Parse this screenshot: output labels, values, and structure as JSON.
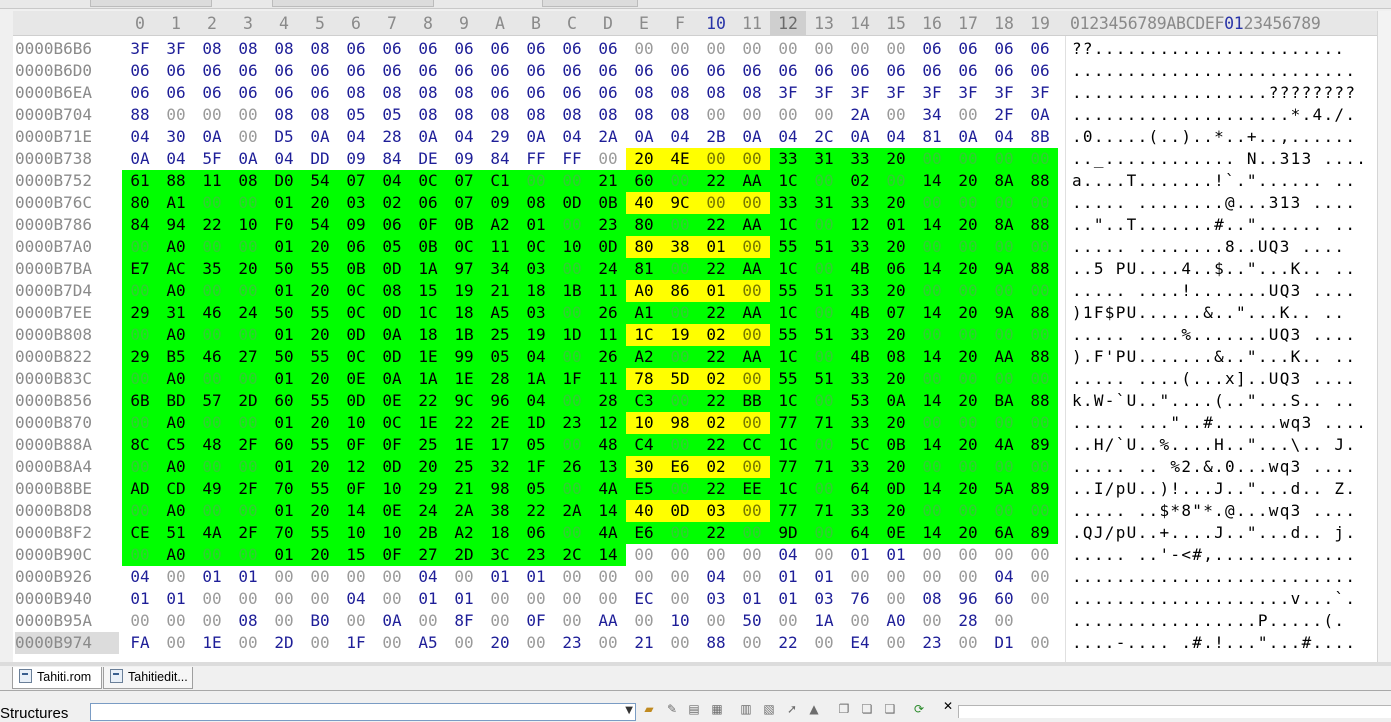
{
  "columns": [
    "0",
    "1",
    "2",
    "3",
    "4",
    "5",
    "6",
    "7",
    "8",
    "9",
    "A",
    "B",
    "C",
    "D",
    "E",
    "F",
    "10",
    "11",
    "12",
    "13",
    "14",
    "15",
    "16",
    "17",
    "18",
    "19"
  ],
  "current_column": "10",
  "selected_column": "12",
  "ascii_header": {
    "before": "0123456789ABCDEF",
    "cur": "01",
    "after": "23456789"
  },
  "rows": [
    {
      "offset": "0000B6B6",
      "bytes": [
        "3F",
        "3F",
        "08",
        "08",
        "08",
        "08",
        "06",
        "06",
        "06",
        "06",
        "06",
        "06",
        "06",
        "06",
        "00",
        "00",
        "00",
        "00",
        "00",
        "00",
        "00",
        "00",
        "06",
        "06",
        "06",
        "06"
      ],
      "ascii": "??......................."
    },
    {
      "offset": "0000B6D0",
      "bytes": [
        "06",
        "06",
        "06",
        "06",
        "06",
        "06",
        "06",
        "06",
        "06",
        "06",
        "06",
        "06",
        "06",
        "06",
        "06",
        "06",
        "06",
        "06",
        "06",
        "06",
        "06",
        "06",
        "06",
        "06",
        "06",
        "06"
      ],
      "ascii": ".........................."
    },
    {
      "offset": "0000B6EA",
      "bytes": [
        "06",
        "06",
        "06",
        "06",
        "06",
        "06",
        "08",
        "08",
        "08",
        "08",
        "06",
        "06",
        "06",
        "06",
        "08",
        "08",
        "08",
        "08",
        "3F",
        "3F",
        "3F",
        "3F",
        "3F",
        "3F",
        "3F",
        "3F"
      ],
      "ascii": "..................????????"
    },
    {
      "offset": "0000B704",
      "bytes": [
        "88",
        "00",
        "00",
        "00",
        "08",
        "08",
        "05",
        "05",
        "08",
        "08",
        "08",
        "08",
        "08",
        "08",
        "08",
        "08",
        "00",
        "00",
        "00",
        "00",
        "2A",
        "00",
        "34",
        "00",
        "2F",
        "0A"
      ],
      "ascii": "....................*.4./."
    },
    {
      "offset": "0000B71E",
      "bytes": [
        "04",
        "30",
        "0A",
        "00",
        "D5",
        "0A",
        "04",
        "28",
        "0A",
        "04",
        "29",
        "0A",
        "04",
        "2A",
        "0A",
        "04",
        "2B",
        "0A",
        "04",
        "2C",
        "0A",
        "04",
        "81",
        "0A",
        "04",
        "8B"
      ],
      "ascii": ".0.....(..)..*..+..,......"
    },
    {
      "offset": "0000B738",
      "bytes": [
        "0A",
        "04",
        "5F",
        "0A",
        "04",
        "DD",
        "09",
        "84",
        "DE",
        "09",
        "84",
        "FF",
        "FF",
        "00",
        "20",
        "4E",
        "00",
        "00",
        "33",
        "31",
        "33",
        "20",
        "00",
        "00",
        "00",
        "00"
      ],
      "ascii": ".._............ N..313 ...."
    },
    {
      "offset": "0000B752",
      "bytes": [
        "61",
        "88",
        "11",
        "08",
        "D0",
        "54",
        "07",
        "04",
        "0C",
        "07",
        "C1",
        "00",
        "00",
        "21",
        "60",
        "00",
        "22",
        "AA",
        "1C",
        "00",
        "02",
        "00",
        "14",
        "20",
        "8A",
        "88"
      ],
      "ascii": "a....T.......!`.\"...... .."
    },
    {
      "offset": "0000B76C",
      "bytes": [
        "80",
        "A1",
        "00",
        "00",
        "01",
        "20",
        "03",
        "02",
        "06",
        "07",
        "09",
        "08",
        "0D",
        "0B",
        "40",
        "9C",
        "00",
        "00",
        "33",
        "31",
        "33",
        "20",
        "00",
        "00",
        "00",
        "00"
      ],
      "ascii": "..... ........@...313 ...."
    },
    {
      "offset": "0000B786",
      "bytes": [
        "84",
        "94",
        "22",
        "10",
        "F0",
        "54",
        "09",
        "06",
        "0F",
        "0B",
        "A2",
        "01",
        "00",
        "23",
        "80",
        "00",
        "22",
        "AA",
        "1C",
        "00",
        "12",
        "01",
        "14",
        "20",
        "8A",
        "88"
      ],
      "ascii": "..\"..T.......#..\"...... .."
    },
    {
      "offset": "0000B7A0",
      "bytes": [
        "00",
        "A0",
        "00",
        "00",
        "01",
        "20",
        "06",
        "05",
        "0B",
        "0C",
        "11",
        "0C",
        "10",
        "0D",
        "80",
        "38",
        "01",
        "00",
        "55",
        "51",
        "33",
        "20",
        "00",
        "00",
        "00",
        "00"
      ],
      "ascii": "..... ........8..UQ3 ...."
    },
    {
      "offset": "0000B7BA",
      "bytes": [
        "E7",
        "AC",
        "35",
        "20",
        "50",
        "55",
        "0B",
        "0D",
        "1A",
        "97",
        "34",
        "03",
        "00",
        "24",
        "81",
        "00",
        "22",
        "AA",
        "1C",
        "00",
        "4B",
        "06",
        "14",
        "20",
        "9A",
        "88"
      ],
      "ascii": "..5 PU....4..$..\"...K.. .."
    },
    {
      "offset": "0000B7D4",
      "bytes": [
        "00",
        "A0",
        "00",
        "00",
        "01",
        "20",
        "0C",
        "08",
        "15",
        "19",
        "21",
        "18",
        "1B",
        "11",
        "A0",
        "86",
        "01",
        "00",
        "55",
        "51",
        "33",
        "20",
        "00",
        "00",
        "00",
        "00"
      ],
      "ascii": "..... ....!.......UQ3 ...."
    },
    {
      "offset": "0000B7EE",
      "bytes": [
        "29",
        "31",
        "46",
        "24",
        "50",
        "55",
        "0C",
        "0D",
        "1C",
        "18",
        "A5",
        "03",
        "00",
        "26",
        "A1",
        "00",
        "22",
        "AA",
        "1C",
        "00",
        "4B",
        "07",
        "14",
        "20",
        "9A",
        "88"
      ],
      "ascii": ")1F$PU......&..\"...K.. .."
    },
    {
      "offset": "0000B808",
      "bytes": [
        "00",
        "A0",
        "00",
        "00",
        "01",
        "20",
        "0D",
        "0A",
        "18",
        "1B",
        "25",
        "19",
        "1D",
        "11",
        "1C",
        "19",
        "02",
        "00",
        "55",
        "51",
        "33",
        "20",
        "00",
        "00",
        "00",
        "00"
      ],
      "ascii": "..... ....%.......UQ3 ...."
    },
    {
      "offset": "0000B822",
      "bytes": [
        "29",
        "B5",
        "46",
        "27",
        "50",
        "55",
        "0C",
        "0D",
        "1E",
        "99",
        "05",
        "04",
        "00",
        "26",
        "A2",
        "00",
        "22",
        "AA",
        "1C",
        "00",
        "4B",
        "08",
        "14",
        "20",
        "AA",
        "88"
      ],
      "ascii": ").F'PU.......&..\"...K.. .."
    },
    {
      "offset": "0000B83C",
      "bytes": [
        "00",
        "A0",
        "00",
        "00",
        "01",
        "20",
        "0E",
        "0A",
        "1A",
        "1E",
        "28",
        "1A",
        "1F",
        "11",
        "78",
        "5D",
        "02",
        "00",
        "55",
        "51",
        "33",
        "20",
        "00",
        "00",
        "00",
        "00"
      ],
      "ascii": "..... ....(...x]..UQ3 ...."
    },
    {
      "offset": "0000B856",
      "bytes": [
        "6B",
        "BD",
        "57",
        "2D",
        "60",
        "55",
        "0D",
        "0E",
        "22",
        "9C",
        "96",
        "04",
        "00",
        "28",
        "C3",
        "00",
        "22",
        "BB",
        "1C",
        "00",
        "53",
        "0A",
        "14",
        "20",
        "BA",
        "88"
      ],
      "ascii": "k.W-`U..\"....(..\"...S.. .."
    },
    {
      "offset": "0000B870",
      "bytes": [
        "00",
        "A0",
        "00",
        "00",
        "01",
        "20",
        "10",
        "0C",
        "1E",
        "22",
        "2E",
        "1D",
        "23",
        "12",
        "10",
        "98",
        "02",
        "00",
        "77",
        "71",
        "33",
        "20",
        "00",
        "00",
        "00",
        "00"
      ],
      "ascii": "..... ...\"..#......wq3 ...."
    },
    {
      "offset": "0000B88A",
      "bytes": [
        "8C",
        "C5",
        "48",
        "2F",
        "60",
        "55",
        "0F",
        "0F",
        "25",
        "1E",
        "17",
        "05",
        "00",
        "48",
        "C4",
        "00",
        "22",
        "CC",
        "1C",
        "00",
        "5C",
        "0B",
        "14",
        "20",
        "4A",
        "89"
      ],
      "ascii": "..H/`U..%....H..\"...\\.. J."
    },
    {
      "offset": "0000B8A4",
      "bytes": [
        "00",
        "A0",
        "00",
        "00",
        "01",
        "20",
        "12",
        "0D",
        "20",
        "25",
        "32",
        "1F",
        "26",
        "13",
        "30",
        "E6",
        "02",
        "00",
        "77",
        "71",
        "33",
        "20",
        "00",
        "00",
        "00",
        "00"
      ],
      "ascii": "..... .. %2.&.0...wq3 ...."
    },
    {
      "offset": "0000B8BE",
      "bytes": [
        "AD",
        "CD",
        "49",
        "2F",
        "70",
        "55",
        "0F",
        "10",
        "29",
        "21",
        "98",
        "05",
        "00",
        "4A",
        "E5",
        "00",
        "22",
        "EE",
        "1C",
        "00",
        "64",
        "0D",
        "14",
        "20",
        "5A",
        "89"
      ],
      "ascii": "..I/pU..)!...J..\"...d.. Z."
    },
    {
      "offset": "0000B8D8",
      "bytes": [
        "00",
        "A0",
        "00",
        "00",
        "01",
        "20",
        "14",
        "0E",
        "24",
        "2A",
        "38",
        "22",
        "2A",
        "14",
        "40",
        "0D",
        "03",
        "00",
        "77",
        "71",
        "33",
        "20",
        "00",
        "00",
        "00",
        "00"
      ],
      "ascii": "..... ..$*8\"*.@...wq3 ...."
    },
    {
      "offset": "0000B8F2",
      "bytes": [
        "CE",
        "51",
        "4A",
        "2F",
        "70",
        "55",
        "10",
        "10",
        "2B",
        "A2",
        "18",
        "06",
        "00",
        "4A",
        "E6",
        "00",
        "22",
        "00",
        "9D",
        "00",
        "64",
        "0E",
        "14",
        "20",
        "6A",
        "89"
      ],
      "ascii": ".QJ/pU..+....J..\"...d.. j."
    },
    {
      "offset": "0000B90C",
      "bytes": [
        "00",
        "A0",
        "00",
        "00",
        "01",
        "20",
        "15",
        "0F",
        "27",
        "2D",
        "3C",
        "23",
        "2C",
        "14",
        "00",
        "00",
        "00",
        "00",
        "04",
        "00",
        "01",
        "01",
        "00",
        "00",
        "00",
        "00"
      ],
      "ascii": "..... ..'-<#,............."
    },
    {
      "offset": "0000B926",
      "bytes": [
        "04",
        "00",
        "01",
        "01",
        "00",
        "00",
        "00",
        "00",
        "04",
        "00",
        "01",
        "01",
        "00",
        "00",
        "00",
        "00",
        "04",
        "00",
        "01",
        "01",
        "00",
        "00",
        "00",
        "00",
        "04",
        "00"
      ],
      "ascii": ".........................."
    },
    {
      "offset": "0000B940",
      "bytes": [
        "01",
        "01",
        "00",
        "00",
        "00",
        "00",
        "04",
        "00",
        "01",
        "01",
        "00",
        "00",
        "00",
        "00",
        "EC",
        "00",
        "03",
        "01",
        "01",
        "03",
        "76",
        "00",
        "08",
        "96",
        "60",
        "00"
      ],
      "ascii": "....................v...`."
    },
    {
      "offset": "0000B95A",
      "bytes": [
        "00",
        "00",
        "00",
        "08",
        "00",
        "B0",
        "00",
        "0A",
        "00",
        "8F",
        "00",
        "0F",
        "00",
        "AA",
        "00",
        "10",
        "00",
        "50",
        "00",
        "1A",
        "00",
        "A0",
        "00",
        "28",
        "00",
        ""
      ],
      "ascii": ".................P.....(."
    },
    {
      "offset": "0000B974",
      "bytes": [
        "FA",
        "00",
        "1E",
        "00",
        "2D",
        "00",
        "1F",
        "00",
        "A5",
        "00",
        "20",
        "00",
        "23",
        "00",
        "21",
        "00",
        "88",
        "00",
        "22",
        "00",
        "E4",
        "00",
        "23",
        "00",
        "D1",
        "00"
      ],
      "ascii": "....-.... .#.!...\"...#...."
    }
  ],
  "selected_offset_row": "0000B974",
  "tabs": [
    {
      "label": "Tahiti.rom",
      "active": true
    },
    {
      "label": "Tahitiedit...",
      "active": false
    }
  ],
  "bottom_panel": {
    "label": "Structures"
  },
  "colors": {
    "selection_green": "#00ff00",
    "highlight_yellow": "#ffff00",
    "nonzero_byte": "#1e1e98",
    "zero_byte": "#9a9a9a"
  }
}
